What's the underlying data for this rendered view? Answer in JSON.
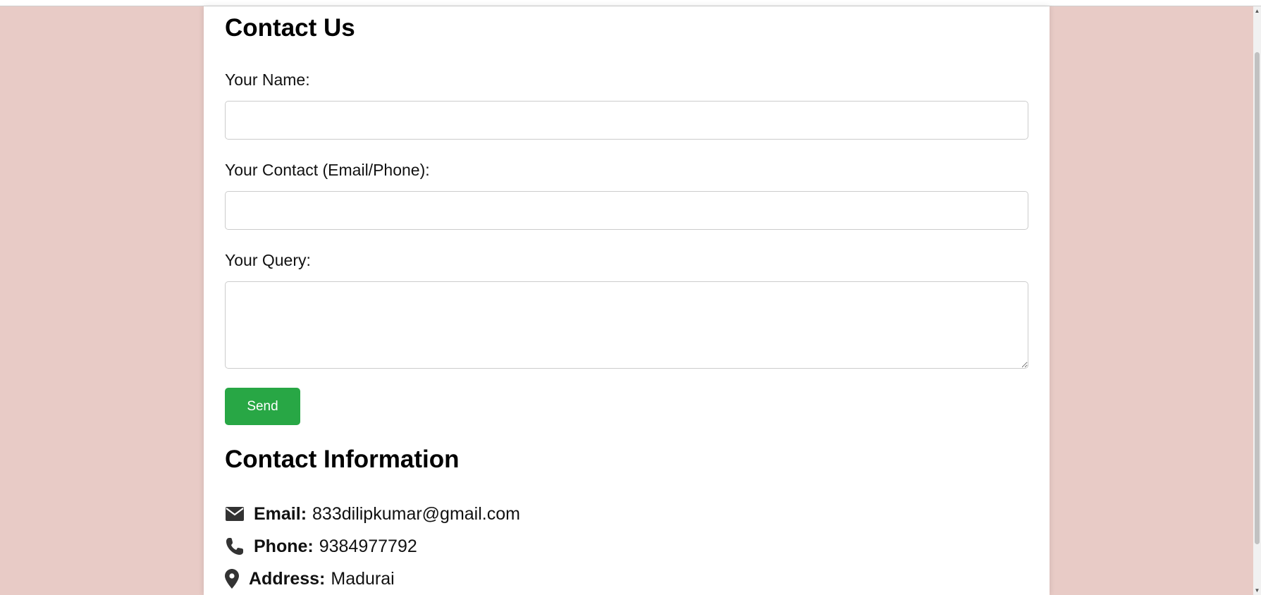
{
  "page": {
    "background_color": "#e8cbc6",
    "card_color": "#ffffff"
  },
  "form": {
    "title": "Contact Us",
    "name_label": "Your Name:",
    "name_value": "",
    "contact_label": "Your Contact (Email/Phone):",
    "contact_value": "",
    "query_label": "Your Query:",
    "query_value": "",
    "send_label": "Send",
    "send_color": "#28a745"
  },
  "contact_info": {
    "title": "Contact Information",
    "email_key": "Email:",
    "email_value": "833dilipkumar@gmail.com",
    "email_icon": "envelope-icon",
    "phone_key": "Phone:",
    "phone_value": "9384977792",
    "phone_icon": "phone-icon",
    "address_key": "Address:",
    "address_value": "Madurai",
    "address_icon": "map-marker-icon"
  }
}
